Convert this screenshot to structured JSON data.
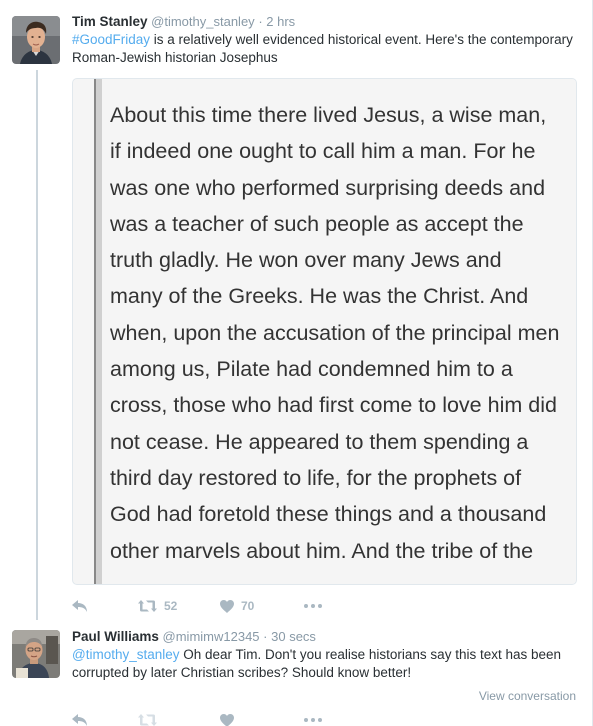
{
  "tweets": [
    {
      "fullname": "Tim Stanley",
      "username": "@timothy_stanley",
      "separator": "·",
      "time": "2 hrs",
      "hashtag": "#GoodFriday",
      "text": " is a relatively well evidenced historical event. Here's the contemporary Roman-Jewish historian Josephus",
      "media_text": "About this time there lived Jesus, a wise man, if indeed one ought to call him a man. For he was one who performed surprising deeds and was a teacher of such people as accept the truth gladly. He won over many Jews and many of the Greeks. He was the Christ. And when, upon the accusation of the principal men among us, Pilate had condemned him to a cross, those who had first come to love him did not cease. He appeared to them spending a third day restored to life, for the prophets of God had foretold these things and a thousand other marvels about him. And the tribe of the",
      "actions": {
        "retweets": "52",
        "likes": "70"
      }
    },
    {
      "fullname": "Paul Williams",
      "username": "@mimimw12345",
      "separator": "·",
      "time": "30 secs",
      "mention": "@timothy_stanley",
      "text": " Oh dear Tim. Don't you realise historians say this text has been corrupted by later Christian scribes? Should know better!",
      "view_conversation": "View conversation"
    }
  ],
  "icons": {
    "reply": "reply-icon",
    "retweet": "retweet-icon",
    "like": "heart-icon",
    "more": "more-icon"
  },
  "colors": {
    "link": "#55acee",
    "icon": "#aab8c2",
    "meta": "#8899a6",
    "text": "#292f33"
  }
}
